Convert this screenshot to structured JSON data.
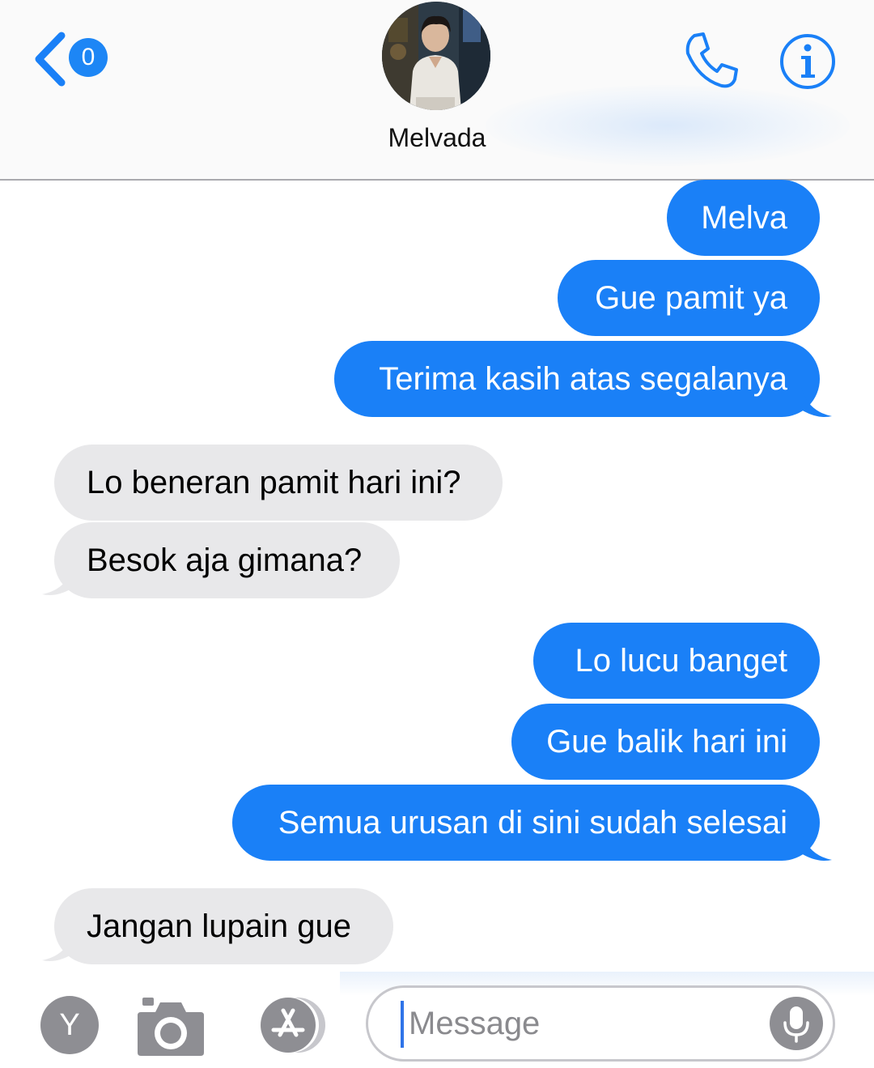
{
  "header": {
    "badge_count": "0",
    "contact_name": "Melvada",
    "accent_color": "#1a80f7"
  },
  "messages": [
    {
      "direction": "outgoing",
      "text": "Melva"
    },
    {
      "direction": "outgoing",
      "text": "Gue pamit ya"
    },
    {
      "direction": "outgoing",
      "text": "Terima kasih atas segalanya"
    },
    {
      "direction": "incoming",
      "text": "Lo beneran pamit hari ini?"
    },
    {
      "direction": "incoming",
      "text": "Besok aja gimana?"
    },
    {
      "direction": "outgoing",
      "text": "Lo lucu banget"
    },
    {
      "direction": "outgoing",
      "text": "Gue balik hari ini"
    },
    {
      "direction": "outgoing",
      "text": "Semua urusan di sini sudah selesai"
    },
    {
      "direction": "incoming",
      "text": "Jangan lupain gue"
    }
  ],
  "input_bar": {
    "app_button_label": "Y",
    "placeholder": "Message",
    "icons": [
      "camera-icon",
      "app-store-icon",
      "microphone-icon"
    ]
  },
  "colors": {
    "outgoing_bubble": "#1a80f7",
    "incoming_bubble": "#e8e8ea"
  }
}
